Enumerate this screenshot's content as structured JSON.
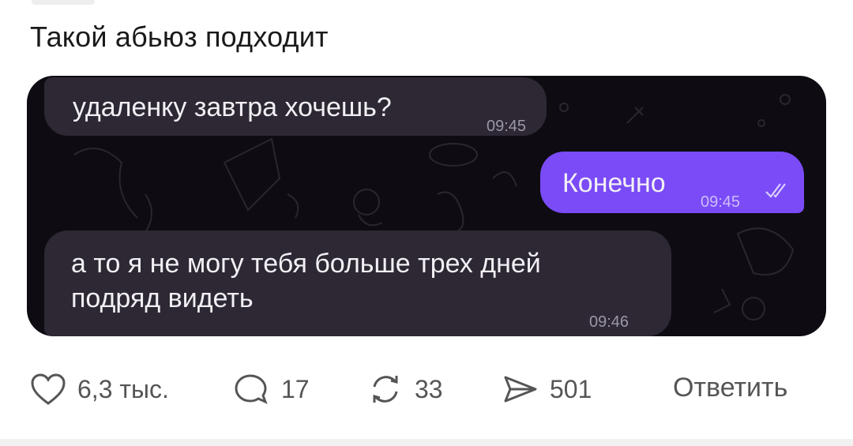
{
  "post": {
    "text": "Такой абьюз подходит"
  },
  "chat": {
    "messages": [
      {
        "text": "удаленку завтра хочешь?",
        "time": "09:45",
        "direction": "incoming"
      },
      {
        "text": "Конечно",
        "time": "09:45",
        "direction": "outgoing",
        "status": "read"
      },
      {
        "text": "а то я не могу тебя больше трех дней\nподряд видеть",
        "time": "09:46",
        "direction": "incoming"
      }
    ],
    "colors": {
      "background": "#0e0c12",
      "incoming": "#2d2833",
      "outgoing": "#7a4bf7"
    }
  },
  "actions": {
    "likes": "6,3 тыс.",
    "comments": "17",
    "reposts": "33",
    "shares": "501",
    "reply_label": "Ответить",
    "icons": [
      "heart-icon",
      "comment-icon",
      "repost-icon",
      "share-icon"
    ]
  }
}
